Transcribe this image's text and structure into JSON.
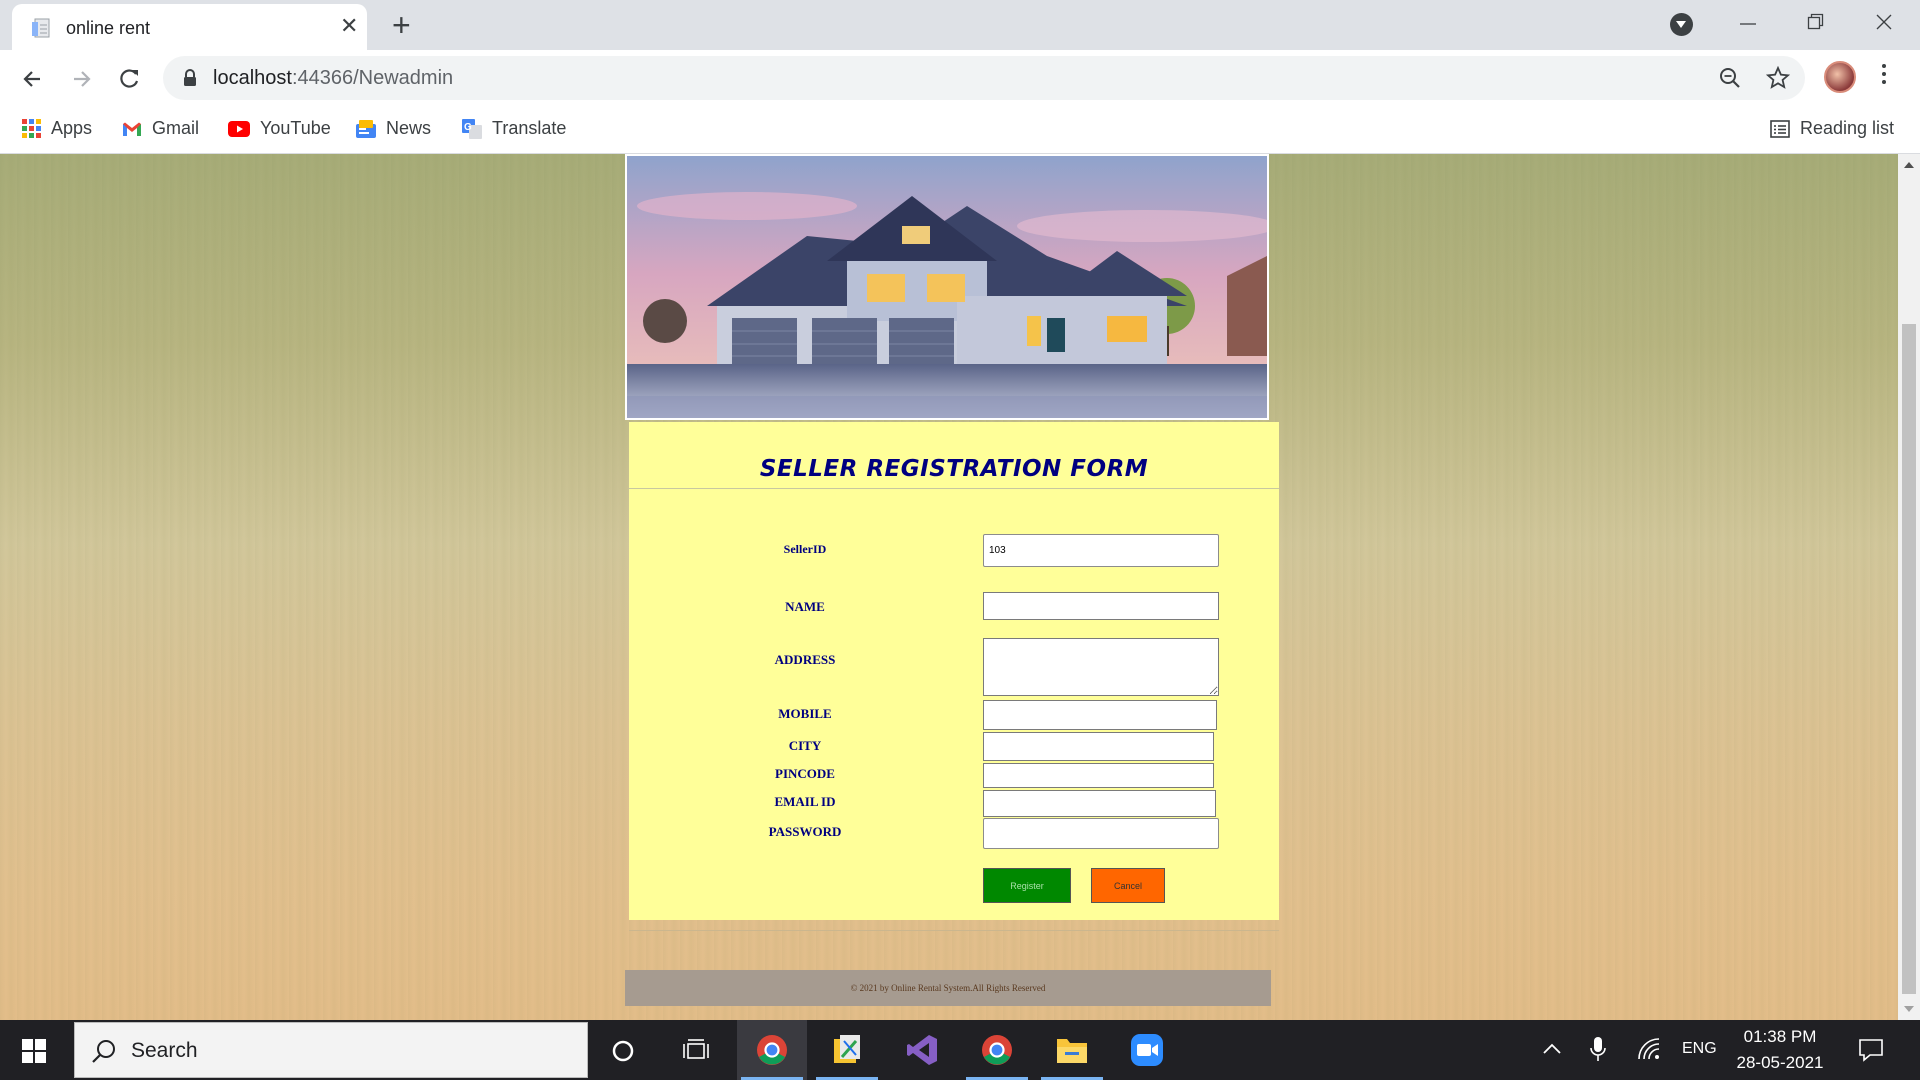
{
  "browser": {
    "tab_title": "online rent",
    "url_host": "localhost",
    "url_path": ":44366/Newadmin",
    "bookmarks": [
      {
        "label": "Apps"
      },
      {
        "label": "Gmail"
      },
      {
        "label": "YouTube"
      },
      {
        "label": "News"
      },
      {
        "label": "Translate"
      }
    ],
    "reading_list": "Reading list"
  },
  "form": {
    "title": "SELLER REGISTRATION FORM",
    "fields": [
      {
        "label": "SellerID",
        "value": "103"
      },
      {
        "label": "NAME",
        "value": ""
      },
      {
        "label": "ADDRESS",
        "value": ""
      },
      {
        "label": "MOBILE",
        "value": ""
      },
      {
        "label": "CITY",
        "value": ""
      },
      {
        "label": "PINCODE",
        "value": ""
      },
      {
        "label": "EMAIL ID",
        "value": ""
      },
      {
        "label": "PASSWORD",
        "value": ""
      }
    ],
    "register_label": "Register",
    "cancel_label": "Cancel"
  },
  "footer": {
    "text": "© 2021 by Online Rental System.All Rights Reserved"
  },
  "taskbar": {
    "search_placeholder": "Search",
    "language": "ENG",
    "time": "01:38 PM",
    "date": "28-05-2021"
  },
  "colors": {
    "form_background": "#ffff99",
    "form_title": "#000080",
    "register_button": "#008800",
    "cancel_button": "#ff6600",
    "footer_background": "#a69b90"
  }
}
